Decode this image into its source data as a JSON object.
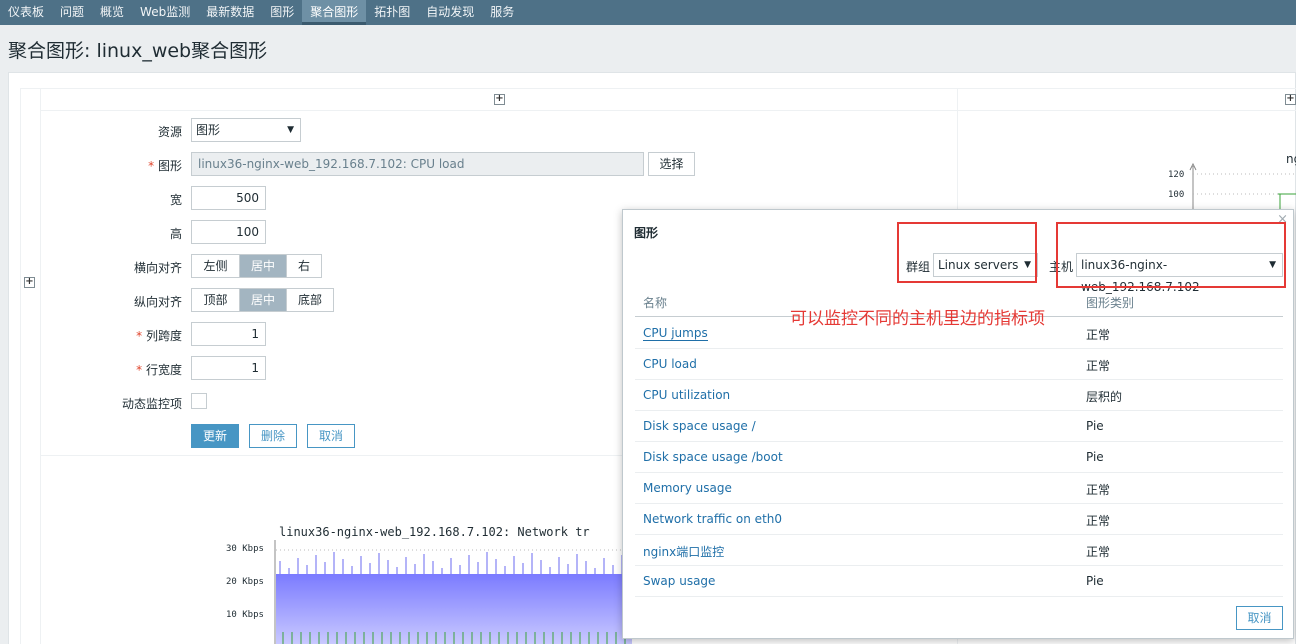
{
  "nav": {
    "items": [
      {
        "label": "仪表板",
        "active": false
      },
      {
        "label": "问题",
        "active": false
      },
      {
        "label": "概览",
        "active": false
      },
      {
        "label": "Web监测",
        "active": false
      },
      {
        "label": "最新数据",
        "active": false
      },
      {
        "label": "图形",
        "active": false
      },
      {
        "label": "聚合图形",
        "active": true
      },
      {
        "label": "拓扑图",
        "active": false
      },
      {
        "label": "自动发现",
        "active": false
      },
      {
        "label": "服务",
        "active": false
      }
    ]
  },
  "page": {
    "title": "聚合图形: linux_web聚合图形"
  },
  "form": {
    "resource_label": "资源",
    "resource_value": "图形",
    "graph_label": "图形",
    "graph_required": "*",
    "graph_value": "linux36-nginx-web_192.168.7.102: CPU load",
    "select_button": "选择",
    "width_label": "宽",
    "width_value": "500",
    "height_label": "高",
    "height_value": "100",
    "halign_label": "横向对齐",
    "halign_options": [
      "左侧",
      "居中",
      "右"
    ],
    "valign_label": "纵向对齐",
    "valign_options": [
      "顶部",
      "居中",
      "底部"
    ],
    "colspan_label": "列跨度",
    "colspan_value": "1",
    "rowspan_label": "行宽度",
    "rowspan_value": "1",
    "dynamic_label": "动态监控项",
    "update_button": "更新",
    "delete_button": "删除",
    "cancel_button": "取消"
  },
  "chart": {
    "title": "linux36-nginx-web_192.168.7.102: Network tr",
    "yticks": [
      "30 Kbps",
      "20 Kbps",
      "10 Kbps"
    ]
  },
  "right_chart": {
    "title_fragment": "ng",
    "yticks": [
      "120",
      "100"
    ]
  },
  "dialog": {
    "title": "图形",
    "group_label": "群组",
    "group_value": "Linux servers",
    "host_label": "主机",
    "host_value": "linux36-nginx-web_192.168.7.102",
    "col_name": "名称",
    "col_type": "图形类别",
    "rows": [
      {
        "name": "CPU jumps",
        "type": "正常"
      },
      {
        "name": "CPU load",
        "type": "正常"
      },
      {
        "name": "CPU utilization",
        "type": "层积的"
      },
      {
        "name": "Disk space usage /",
        "type": "Pie"
      },
      {
        "name": "Disk space usage /boot",
        "type": "Pie"
      },
      {
        "name": "Memory usage",
        "type": "正常"
      },
      {
        "name": "Network traffic on eth0",
        "type": "正常"
      },
      {
        "name": "nginx端口监控",
        "type": "正常"
      },
      {
        "name": "Swap usage",
        "type": "Pie"
      }
    ],
    "cancel_button": "取消",
    "annotation": "可以监控不同的主机里边的指标项"
  },
  "icons": {
    "plus": "+",
    "caret": "▼",
    "close": "×"
  }
}
